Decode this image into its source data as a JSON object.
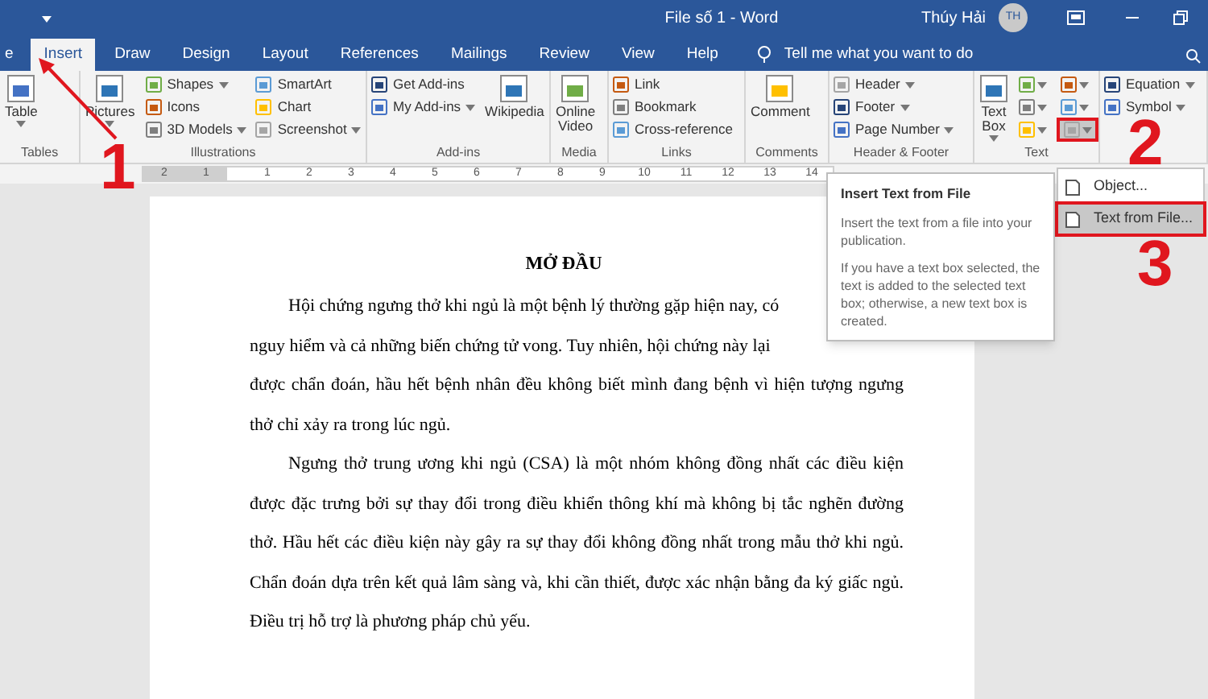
{
  "title_bar": {
    "title": "File số 1 - Word",
    "user": "Thúy Hải",
    "avatar": "TH"
  },
  "tabs": [
    {
      "label": "e",
      "selected": false
    },
    {
      "label": "Insert",
      "selected": true
    },
    {
      "label": "Draw",
      "selected": false
    },
    {
      "label": "Design",
      "selected": false
    },
    {
      "label": "Layout",
      "selected": false
    },
    {
      "label": "References",
      "selected": false
    },
    {
      "label": "Mailings",
      "selected": false
    },
    {
      "label": "Review",
      "selected": false
    },
    {
      "label": "View",
      "selected": false
    },
    {
      "label": "Help",
      "selected": false
    }
  ],
  "tell_me": {
    "placeholder": "Tell me what you want to do"
  },
  "ribbon_groups": [
    {
      "label": "Tables",
      "items": [
        {
          "label": "Table",
          "kind": "large",
          "dropdown": true
        }
      ]
    },
    {
      "label": "Illustrations",
      "items": [
        {
          "label": "Pictures",
          "kind": "large",
          "dropdown": true
        },
        {
          "label": "Shapes",
          "kind": "small",
          "dropdown": true
        },
        {
          "label": "Icons",
          "kind": "small",
          "dropdown": false
        },
        {
          "label": "3D Models",
          "kind": "small",
          "dropdown": true
        },
        {
          "label": "SmartArt",
          "kind": "small",
          "dropdown": false
        },
        {
          "label": "Chart",
          "kind": "small",
          "dropdown": false
        },
        {
          "label": "Screenshot",
          "kind": "small",
          "dropdown": true
        }
      ]
    },
    {
      "label": "Add-ins",
      "items": [
        {
          "label": "Get Add-ins",
          "kind": "small",
          "dropdown": false
        },
        {
          "label": "My Add-ins",
          "kind": "small",
          "dropdown": true
        },
        {
          "label": "Wikipedia",
          "kind": "large",
          "dropdown": false
        }
      ]
    },
    {
      "label": "Media",
      "items": [
        {
          "label": "Online Video",
          "kind": "large",
          "dropdown": false
        }
      ]
    },
    {
      "label": "Links",
      "items": [
        {
          "label": "Link",
          "kind": "small",
          "dropdown": false
        },
        {
          "label": "Bookmark",
          "kind": "small",
          "dropdown": false
        },
        {
          "label": "Cross-reference",
          "kind": "small",
          "dropdown": false
        }
      ]
    },
    {
      "label": "Comments",
      "items": [
        {
          "label": "Comment",
          "kind": "large",
          "dropdown": false
        }
      ]
    },
    {
      "label": "Header & Footer",
      "items": [
        {
          "label": "Header",
          "kind": "small",
          "dropdown": true
        },
        {
          "label": "Footer",
          "kind": "small",
          "dropdown": true
        },
        {
          "label": "Page Number",
          "kind": "small",
          "dropdown": true
        }
      ]
    },
    {
      "label": "Text",
      "items": [
        {
          "label": "Text Box",
          "kind": "large",
          "dropdown": true
        },
        {
          "kind": "icon-grid"
        }
      ]
    },
    {
      "items": [
        {
          "label": "Equation",
          "kind": "small",
          "dropdown": true
        },
        {
          "label": "Symbol",
          "kind": "small",
          "dropdown": true
        }
      ]
    }
  ],
  "ruler": [
    "2",
    "1",
    "1",
    "2",
    "3",
    "4",
    "5",
    "6",
    "7",
    "8",
    "9",
    "10",
    "11",
    "12",
    "13",
    "14"
  ],
  "document": {
    "heading": "MỞ ĐẦU",
    "lines": [
      {
        "text": "Hội chứng ngưng thở khi ngủ là một bệnh lý thường gặp hiện nay, có",
        "indent": true,
        "full": false
      },
      {
        "text": "nguy hiểm và cả những biến chứng tử vong. Tuy nhiên, hội chứng này lại",
        "indent": false,
        "full": false
      },
      {
        "text": "được chẩn đoán, hầu hết bệnh nhân đều không biết mình đang bệnh vì hiện tượng ngưng",
        "indent": false,
        "full": true
      },
      {
        "text": "thở chỉ xảy ra trong lúc ngủ.",
        "indent": false,
        "full": false
      },
      {
        "text": "Ngưng thở trung ương khi ngủ (CSA) là một nhóm không đồng nhất các điều kiện",
        "indent": true,
        "full": true
      },
      {
        "text": "được đặc trưng bởi sự thay đổi trong điều khiển thông khí mà không bị tắc nghẽn đường",
        "indent": false,
        "full": true
      },
      {
        "text": "thở. Hầu hết các điều kiện này gây ra sự thay đổi không đồng nhất trong mẫu thở khi ngủ.",
        "indent": false,
        "full": true
      },
      {
        "text": "Chẩn đoán dựa trên kết quả lâm sàng và, khi cần thiết, được xác nhận bằng đa ký giấc ngủ.",
        "indent": false,
        "full": true
      },
      {
        "text": "Điều trị hỗ trợ là phương pháp chủ yếu.",
        "indent": false,
        "full": false
      }
    ]
  },
  "menu": [
    {
      "label": "Object...",
      "selected": false
    },
    {
      "label": "Text from File...",
      "selected": true
    }
  ],
  "tooltip": {
    "title": "Insert Text from File",
    "paragraphs": [
      "Insert the text from a file into your publication.",
      "If you have a text box selected, the text is added to the selected text box; otherwise, a new text box is created."
    ]
  },
  "annotations": [
    "1",
    "2",
    "3"
  ]
}
